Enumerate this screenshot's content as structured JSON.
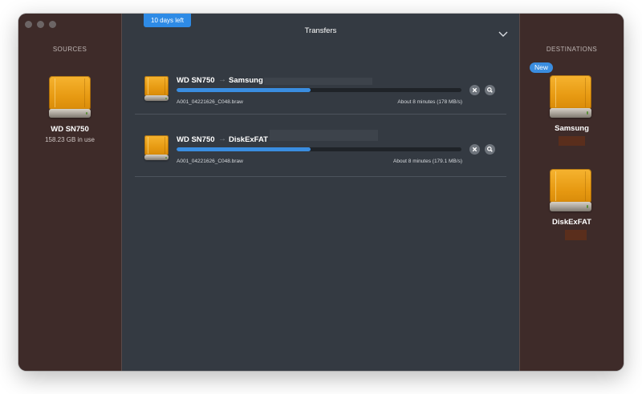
{
  "window": {
    "title": "Transfers",
    "trial_badge": "10 days left"
  },
  "sources": {
    "title": "SOURCES",
    "drive_name": "WD SN750",
    "drive_usage": "158.23 GB in use"
  },
  "destinations": {
    "title": "DESTINATIONS",
    "new_badge": "New",
    "items": [
      {
        "name": "Samsung"
      },
      {
        "name": "DiskExFAT"
      }
    ]
  },
  "transfers": [
    {
      "from": "WD SN750",
      "arrow": "→",
      "to": "Samsung",
      "progress": 0.47,
      "file": "A001_04221626_C048.braw",
      "eta": "About 8 minutes (178 MB/s)"
    },
    {
      "from": "WD SN750",
      "arrow": "→",
      "to": "DiskExFAT",
      "progress": 0.47,
      "file": "A001_04221626_C048.braw",
      "eta": "About 8 minutes (179.1 MB/s)"
    }
  ],
  "colors": {
    "accent": "#3a8de0",
    "sidebar_bg": "#3e2b29",
    "main_bg": "#343a42",
    "drive_orange": "#f0a81e"
  },
  "icons": {
    "cancel": "close-icon",
    "reveal": "magnifier-icon",
    "collapse": "chevron-down-icon",
    "drive": "external-drive-icon"
  }
}
